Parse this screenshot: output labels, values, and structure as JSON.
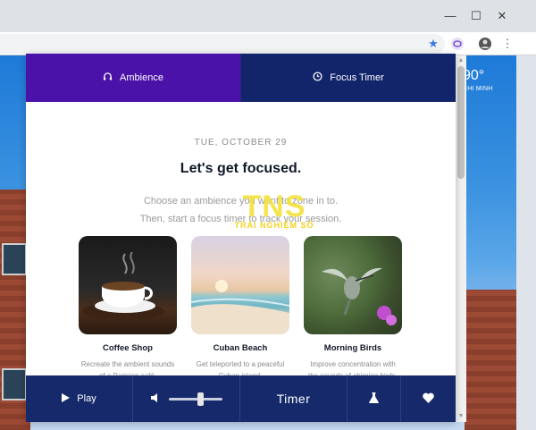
{
  "weather": {
    "temp": "90°",
    "city": "CHI MINH"
  },
  "tabs": {
    "ambience": "Ambience",
    "focus_timer": "Focus Timer"
  },
  "content": {
    "date": "TUE, OCTOBER 29",
    "title": "Let's get focused.",
    "subtitle_line1": "Choose an ambience you want to zone in to.",
    "subtitle_line2": "Then, start a focus timer to track your session."
  },
  "cards": [
    {
      "title": "Coffee Shop",
      "desc_line1": "Recreate the ambient sounds",
      "desc_line2": "of a Parisian café."
    },
    {
      "title": "Cuban Beach",
      "desc_line1": "Get teleported to a peaceful",
      "desc_line2": "Cuban island."
    },
    {
      "title": "Morning Birds",
      "desc_line1": "Improve concentration with",
      "desc_line2": "the sounds of chirping birds."
    }
  ],
  "player": {
    "play_label": "Play",
    "timer_label": "Timer",
    "volume": 0.6
  },
  "watermark": {
    "big": "TNS",
    "small": "TRẢI NGHIỆM SỐ"
  },
  "colors": {
    "ambience_tab": "#4a12a8",
    "focus_tab": "#12246a",
    "player_bar": "#162a6b"
  }
}
